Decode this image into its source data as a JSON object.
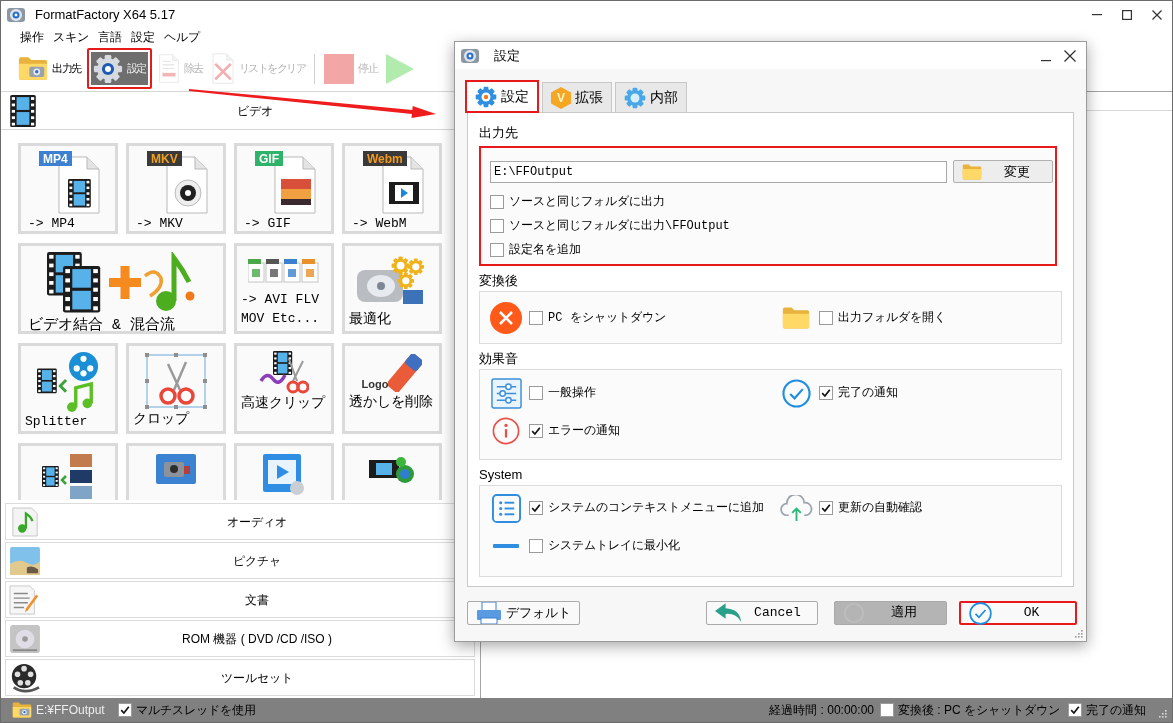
{
  "callout_arrow": true,
  "window": {
    "title": "FormatFactory X64 5.17"
  },
  "menu": [
    "操作",
    "スキン",
    "言語",
    "設定",
    "ヘルプ"
  ],
  "toolbar": [
    {
      "kind": "button",
      "label": "出力先",
      "disabled": false,
      "pressed": false,
      "highlighted": false
    },
    {
      "kind": "button",
      "label": "設定",
      "disabled": false,
      "pressed": true,
      "highlighted": true
    },
    {
      "kind": "button",
      "label": "除去",
      "disabled": true,
      "pressed": false,
      "highlighted": false
    },
    {
      "kind": "button",
      "label": "リストをクリア",
      "disabled": true,
      "pressed": false,
      "highlighted": false
    },
    {
      "kind": "separator"
    },
    {
      "kind": "button",
      "label": "停止",
      "disabled": true,
      "pressed": false,
      "highlighted": false
    },
    {
      "kind": "button",
      "disabled": true,
      "pressed": false,
      "highlighted": false
    }
  ],
  "video": {
    "title": "ビデオ",
    "tiles": [
      {
        "kind": "file",
        "badge": "MP4",
        "label": "-> MP4"
      },
      {
        "kind": "file",
        "badge": "MKV",
        "label": "-> MKV"
      },
      {
        "kind": "file",
        "badge": "GIF",
        "label": "-> GIF"
      },
      {
        "kind": "file",
        "badge": "Webm",
        "label": "-> WebM"
      },
      {
        "kind": "wide",
        "label": "ビデオ結合 & 混合流"
      },
      {
        "kind": "tool",
        "label": "-> AVI FLV\nMOV Etc..."
      },
      {
        "kind": "tool",
        "label": "最適化"
      },
      {
        "kind": "tool",
        "label": "Splitter"
      },
      {
        "kind": "tool",
        "label": "クロップ"
      },
      {
        "kind": "tool",
        "label": "高速クリップ"
      },
      {
        "kind": "tool",
        "label": "透かしを削除",
        "icon_text": "Logo"
      },
      {
        "kind": "clipped"
      },
      {
        "kind": "clipped"
      },
      {
        "kind": "clipped"
      },
      {
        "kind": "clipped"
      }
    ]
  },
  "categories": [
    "オーディオ",
    "ピクチャ",
    "文書",
    "ROM 機器 ( DVD /CD /ISO )",
    "ツールセット"
  ],
  "status_bar": {
    "path": "E:¥FFOutput",
    "multithread": {
      "label": "マルチスレッドを使用",
      "checked": true
    },
    "elapsed": "経過時間 : 00:00:00",
    "shutdown": {
      "label": "変換後 : PC をシャットダウン",
      "checked": false
    },
    "notify": {
      "label": "完了の通知",
      "checked": true
    }
  },
  "dialog": {
    "title": "設定",
    "tabs": [
      {
        "label": "設定",
        "selected": true,
        "highlighted": true
      },
      {
        "label": "拡張",
        "badge": "V",
        "selected": false,
        "highlighted": false
      },
      {
        "label": "内部",
        "selected": false,
        "highlighted": false
      }
    ],
    "output": {
      "title": "出力先",
      "highlighted": true,
      "path": "E:\\FFOutput",
      "change_button": "変更",
      "options": [
        {
          "label": "ソースと同じフォルダに出力",
          "checked": false
        },
        {
          "label": "ソースと同じフォルダに出力\\FFOutput",
          "checked": false
        },
        {
          "label": "設定名を追加",
          "checked": false
        }
      ]
    },
    "sections": [
      {
        "title": "変換後",
        "options": [
          {
            "label": "PC をシャットダウン",
            "checked": false
          },
          {
            "label": "出力フォルダを開く",
            "checked": false
          }
        ]
      },
      {
        "title": "効果音",
        "options": [
          {
            "label": "一般操作",
            "checked": false
          },
          {
            "label": "完了の通知",
            "checked": true
          },
          {
            "label": "エラーの通知",
            "checked": true
          }
        ]
      },
      {
        "title": "System",
        "options": [
          {
            "label": "システムのコンテキストメニューに追加",
            "checked": true
          },
          {
            "label": "更新の自動確認",
            "checked": true
          },
          {
            "label": "システムトレイに最小化",
            "checked": false
          }
        ]
      }
    ],
    "buttons": [
      {
        "label": "デフォルト",
        "kind": "plain",
        "highlighted": false
      },
      {
        "label": "Cancel",
        "kind": "plain",
        "highlighted": false
      },
      {
        "label": "適用",
        "kind": "shaded",
        "highlighted": false
      },
      {
        "label": "OK",
        "kind": "plain",
        "highlighted": true
      }
    ]
  }
}
